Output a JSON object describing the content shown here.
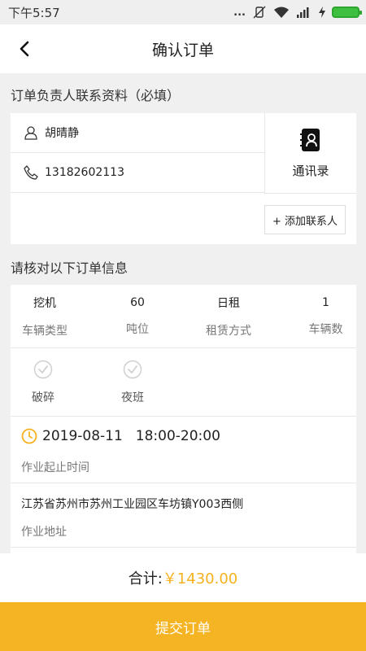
{
  "status_bar": {
    "time": "下午5:57",
    "dots": "..."
  },
  "nav": {
    "title": "确认订单"
  },
  "contact_section": {
    "title": "订单负责人联系资料（必填）",
    "name": "胡晴静",
    "phone": "13182602113",
    "address_book_label": "通讯录",
    "add_contact_label": "+ 添加联系人"
  },
  "order_section": {
    "title": "请核对以下订单信息",
    "specs": [
      {
        "value": "挖机",
        "label": "车辆类型"
      },
      {
        "value": "60",
        "label": "吨位"
      },
      {
        "value": "日租",
        "label": "租赁方式"
      },
      {
        "value": "1",
        "label": "车辆数"
      }
    ],
    "options": [
      {
        "label": "破碎"
      },
      {
        "label": "夜班"
      }
    ],
    "date": "2019-08-11",
    "time_range": "18:00-20:00",
    "time_label": "作业起止时间",
    "address": "江苏省苏州市苏州工业园区车坊镇Y003西侧",
    "address_label": "作业地址"
  },
  "footer": {
    "total_label": "合计:",
    "total_amount": "￥1430.00",
    "submit_label": "提交订单"
  },
  "colors": {
    "accent": "#f5b423",
    "price": "#f5b21e",
    "battery": "#3fbf3f"
  }
}
